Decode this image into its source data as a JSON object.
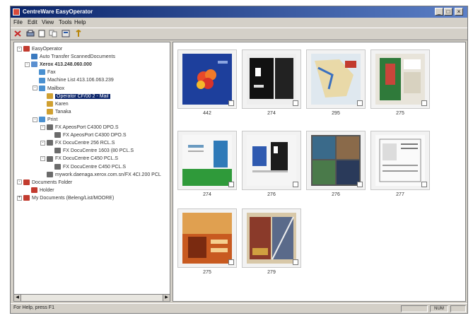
{
  "window": {
    "title": "CentreWare EasyOperator"
  },
  "menu": [
    "File",
    "Edit",
    "View",
    "Tools",
    "Help"
  ],
  "tree": [
    {
      "label": "EasyOperator",
      "indent": 0,
      "icon": "operator-icon",
      "color": "#c23b2f",
      "expander": "-"
    },
    {
      "label": "Auto Transfer ScannedDocuments",
      "indent": 1,
      "icon": "transfer-icon",
      "color": "#3a7ac0",
      "expander": ""
    },
    {
      "label": "Xerox 413.248.060.000",
      "indent": 1,
      "icon": "device-icon",
      "color": "#5a8fd0",
      "expander": "-",
      "bold": true
    },
    {
      "label": "Fax",
      "indent": 2,
      "icon": "fax-icon",
      "color": "#4a90d0",
      "expander": ""
    },
    {
      "label": "Machine List 413.106.063.239",
      "indent": 2,
      "icon": "list-icon",
      "color": "#4a90d0",
      "expander": ""
    },
    {
      "label": "Mailbox",
      "indent": 2,
      "icon": "mailbox-icon",
      "color": "#4a90d0",
      "expander": "-"
    },
    {
      "label": "Operator CF/00 2 - Mail",
      "indent": 3,
      "icon": "folder-icon",
      "color": "#d0a030",
      "expander": "",
      "selected": true
    },
    {
      "label": "Karen",
      "indent": 3,
      "icon": "folder-icon",
      "color": "#d0a030",
      "expander": ""
    },
    {
      "label": "Tanaka",
      "indent": 3,
      "icon": "folder-icon",
      "color": "#d0a030",
      "expander": ""
    },
    {
      "label": "Print",
      "indent": 2,
      "icon": "print-icon",
      "color": "#4a90d0",
      "expander": "-"
    },
    {
      "label": "FX ApeosPort C4300 DPO.S",
      "indent": 3,
      "icon": "printer-icon",
      "color": "#6b6b6b",
      "expander": "-"
    },
    {
      "label": "FX ApeosPort C4300 DPO.S",
      "indent": 4,
      "icon": "printer-icon",
      "color": "#6b6b6b",
      "expander": ""
    },
    {
      "label": "FX DocuCentre 256 RCL.S",
      "indent": 3,
      "icon": "printer-icon",
      "color": "#6b6b6b",
      "expander": "-"
    },
    {
      "label": "FX DocuCentre 1603 (80 PCL.S",
      "indent": 4,
      "icon": "printer-icon",
      "color": "#6b6b6b",
      "expander": ""
    },
    {
      "label": "FX DocuCentre C450 PCL.S",
      "indent": 3,
      "icon": "printer-icon",
      "color": "#6b6b6b",
      "expander": "-"
    },
    {
      "label": "FX DocuCentre C450 PCL.S",
      "indent": 4,
      "icon": "printer-icon",
      "color": "#6b6b6b",
      "expander": ""
    },
    {
      "label": "mywork.daenaga.xerox.com.sn/FX 4CI.200 PCL",
      "indent": 3,
      "icon": "network-printer-icon",
      "color": "#6b6b6b",
      "expander": ""
    },
    {
      "label": "Documents Folder",
      "indent": 0,
      "icon": "documents-folder-icon",
      "color": "#c23b2f",
      "expander": "-"
    },
    {
      "label": "Holder",
      "indent": 1,
      "icon": "folder-icon",
      "color": "#c23b2f",
      "expander": ""
    },
    {
      "label": "My Documents (Beleng/List/MOORE)",
      "indent": 0,
      "icon": "my-documents-icon",
      "color": "#c23b2f",
      "expander": "+"
    }
  ],
  "thumbnails": [
    {
      "caption": "442",
      "style": "fruit"
    },
    {
      "caption": "274",
      "style": "dark"
    },
    {
      "caption": "295",
      "style": "map"
    },
    {
      "caption": "275",
      "style": "mapcolor"
    },
    {
      "caption": "274",
      "style": "green"
    },
    {
      "caption": "276",
      "style": "bluedoc"
    },
    {
      "caption": "276",
      "style": "collage"
    },
    {
      "caption": "277",
      "style": "form"
    },
    {
      "caption": "275",
      "style": "poster"
    },
    {
      "caption": "279",
      "style": "street"
    }
  ],
  "status": {
    "text": "For Help, press F1",
    "num": "NUM"
  },
  "colors": {
    "title_bar": "#0a246a",
    "selection": "#0a246a"
  }
}
